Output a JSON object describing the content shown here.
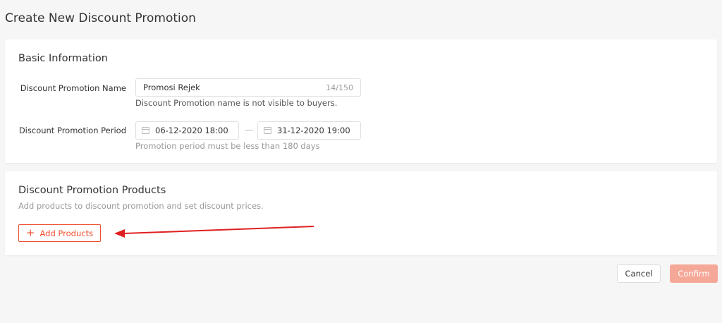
{
  "page": {
    "title": "Create New Discount Promotion"
  },
  "basic_info": {
    "title": "Basic Information",
    "name_label": "Discount Promotion Name",
    "name_value": "Promosi Rejek",
    "name_counter": "14/150",
    "name_hint": "Discount Promotion name is not visible to buyers.",
    "period_label": "Discount Promotion Period",
    "start_date": "06-12-2020 18:00",
    "end_date": "31-12-2020 19:00",
    "period_hint": "Promotion period must be less than 180 days"
  },
  "products": {
    "title": "Discount Promotion Products",
    "subtitle": "Add products to discount promotion and set discount prices.",
    "add_button_label": "Add Products"
  },
  "footer": {
    "cancel_label": "Cancel",
    "confirm_label": "Confirm"
  },
  "colors": {
    "accent": "#ee4d2d",
    "confirm_disabled": "#f5a898",
    "annotation": "#e02020"
  },
  "icons": {
    "date": "calendar-icon",
    "add": "plus-icon"
  }
}
